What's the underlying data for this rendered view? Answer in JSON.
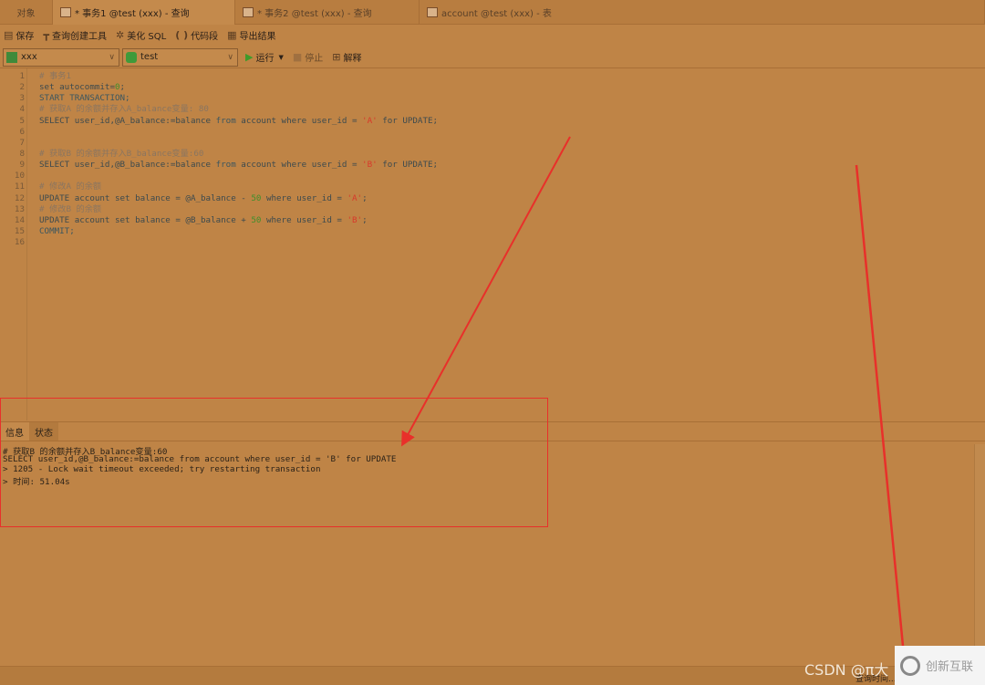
{
  "tabs": [
    {
      "label": "对象",
      "active": false,
      "icon": ""
    },
    {
      "label": "* 事务1 @test (xxx) - 查询",
      "active": true,
      "icon": "query-icon"
    },
    {
      "label": "* 事务2 @test (xxx) - 查询",
      "active": false,
      "icon": "query-icon"
    },
    {
      "label": "account @test (xxx) - 表",
      "active": false,
      "icon": "table-icon"
    }
  ],
  "toolbar": {
    "save": "保存",
    "query_builder": "查询创建工具",
    "beautify": "美化 SQL",
    "snippet": "代码段",
    "export": "导出结果"
  },
  "run_bar": {
    "connection": "xxx",
    "database": "test",
    "run": "运行",
    "stop": "停止",
    "explain": "解释"
  },
  "editor": {
    "lines": [
      [
        {
          "t": "# 事务1",
          "c": "comment"
        }
      ],
      [
        {
          "t": "set autocommit=",
          "c": "plain"
        },
        {
          "t": "0",
          "c": "number"
        },
        {
          "t": ";",
          "c": "plain"
        }
      ],
      [
        {
          "t": "START TRANSACTION;",
          "c": "keyword"
        }
      ],
      [
        {
          "t": "# 获取A 的余额并存入A_balance变量: 80",
          "c": "comment"
        }
      ],
      [
        {
          "t": "SELECT user_id,@A_balance:=balance ",
          "c": "plain"
        },
        {
          "t": "from",
          "c": "keyword"
        },
        {
          "t": " account where user_id = ",
          "c": "plain"
        },
        {
          "t": "'A'",
          "c": "string"
        },
        {
          "t": " for UPDATE;",
          "c": "plain"
        }
      ],
      [],
      [],
      [
        {
          "t": "# 获取B 的余额并存入B_balance变量:60",
          "c": "comment"
        }
      ],
      [
        {
          "t": "SELECT user_id,@B_balance:=balance ",
          "c": "plain"
        },
        {
          "t": "from",
          "c": "keyword"
        },
        {
          "t": " account where user_id = ",
          "c": "plain"
        },
        {
          "t": "'B'",
          "c": "string"
        },
        {
          "t": " for UPDATE;",
          "c": "plain"
        }
      ],
      [],
      [
        {
          "t": "# 修改A 的余额",
          "c": "comment"
        }
      ],
      [
        {
          "t": "UPDATE account set balance = @A_balance - ",
          "c": "plain"
        },
        {
          "t": "50",
          "c": "number"
        },
        {
          "t": " where user_id = ",
          "c": "plain"
        },
        {
          "t": "'A'",
          "c": "string"
        },
        {
          "t": ";",
          "c": "plain"
        }
      ],
      [
        {
          "t": "# 修改B 的余额",
          "c": "comment"
        }
      ],
      [
        {
          "t": "UPDATE account set balance = @B_balance + ",
          "c": "plain"
        },
        {
          "t": "50",
          "c": "number"
        },
        {
          "t": " where user_id = ",
          "c": "plain"
        },
        {
          "t": "'B'",
          "c": "string"
        },
        {
          "t": ";",
          "c": "plain"
        }
      ],
      [
        {
          "t": "COMMIT;",
          "c": "keyword"
        }
      ],
      []
    ]
  },
  "bottom_panel": {
    "tabs": [
      {
        "label": "信息",
        "active": true
      },
      {
        "label": "状态",
        "active": false
      }
    ],
    "messages": [
      "# 获取B 的余额并存入B_balance变量:60",
      "SELECT user_id,@B_balance:=balance from account where user_id = 'B' for UPDATE",
      "> 1205 - Lock wait timeout exceeded; try restarting transaction",
      "> 时间: 51.04s"
    ]
  },
  "status_bar": {
    "text": "查询时间..."
  },
  "watermark": {
    "text": "CSDN @π大",
    "logo_text": "创新互联"
  },
  "colors": {
    "background": "#bf8446",
    "annotation": "#e8302a"
  }
}
